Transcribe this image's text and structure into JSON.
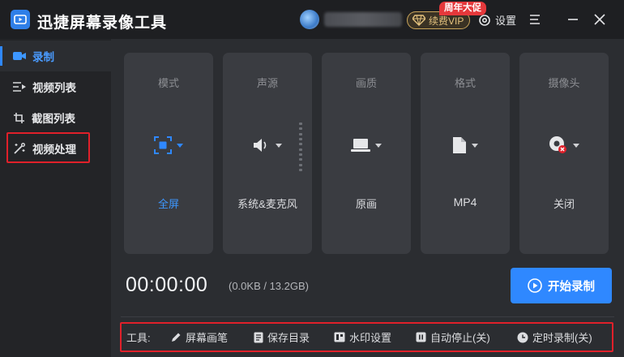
{
  "app": {
    "title": "迅捷屏幕录像工具"
  },
  "header": {
    "vip_label": "续费VIP",
    "promo_badge": "周年大促",
    "settings_label": "设置"
  },
  "sidebar": {
    "items": [
      {
        "label": "录制"
      },
      {
        "label": "视频列表"
      },
      {
        "label": "截图列表"
      },
      {
        "label": "视频处理"
      }
    ]
  },
  "cards": [
    {
      "title": "模式",
      "value": "全屏",
      "icon": "fullscreen-icon"
    },
    {
      "title": "声源",
      "value": "系统&麦克风",
      "icon": "speaker-icon"
    },
    {
      "title": "画质",
      "value": "原画",
      "icon": "laptop-icon"
    },
    {
      "title": "格式",
      "value": "MP4",
      "icon": "file-icon"
    },
    {
      "title": "摄像头",
      "value": "关闭",
      "icon": "webcam-icon"
    }
  ],
  "recording": {
    "timer": "00:00:00",
    "size_info": "(0.0KB / 13.2GB)",
    "start_label": "开始录制"
  },
  "toolbar": {
    "label": "工具:",
    "items": [
      {
        "label": "屏幕画笔",
        "icon": "pen-icon"
      },
      {
        "label": "保存目录",
        "icon": "document-icon"
      },
      {
        "label": "水印设置",
        "icon": "watermark-icon"
      },
      {
        "label": "自动停止(关)",
        "icon": "pause-icon"
      },
      {
        "label": "定时录制(关)",
        "icon": "clock-icon"
      }
    ]
  },
  "colors": {
    "accent": "#2f88ff",
    "highlight": "#e0202a",
    "vip_gold": "#e4c27e",
    "promo_red": "#e5383b"
  }
}
